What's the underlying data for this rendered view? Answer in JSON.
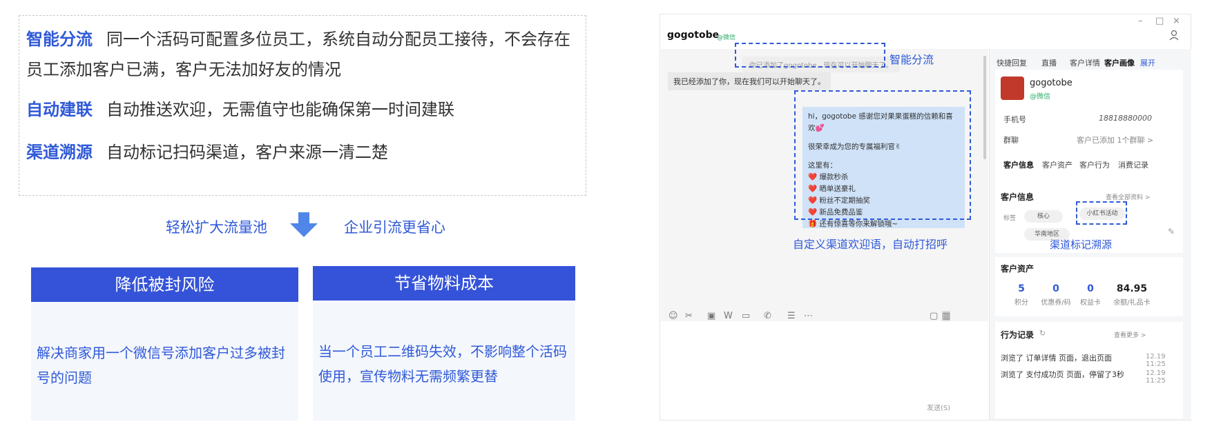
{
  "features": [
    {
      "title": "智能分流",
      "text": "同一个活码可配置多位员工，系统自动分配员工接待，不会存在员工添加客户已满，客户无法加好友的情况"
    },
    {
      "title": "自动建联",
      "text": "自动推送欢迎，无需值守也能确保第一时间建联"
    },
    {
      "title": "渠道溯源",
      "text": "自动标记扫码渠道，客户来源一清二楚"
    }
  ],
  "benefits": {
    "left": "轻松扩大流量池",
    "right": "企业引流更省心"
  },
  "cards": [
    {
      "title": "降低被封风险",
      "body": "解决商家用一个微信号添加客户过多被封号的问题"
    },
    {
      "title": "节省物料成本",
      "body": "当一个员工二维码失效，不影响整个活码使用，宣传物料无需频繁更替"
    }
  ],
  "window": {
    "controls": {
      "min": "–",
      "max": "□",
      "close": "×"
    },
    "contact_name": "gogotobe",
    "contact_source": "@微信",
    "system_msg": "你已添加了gogotobe，现在可以开始聊天了。",
    "received_msg": "我已经添加了你，现在我们可以开始聊天了。",
    "welcome_lines": [
      "hi，gogotobe 感谢您对果果蛋糕的信赖和喜欢💕",
      "",
      "很荣幸成为您的专属福利官✌",
      "",
      "这里有：",
      "❤️ 爆款秒杀",
      "❤️ 晒单送豪礼",
      "❤️ 粉丝不定期抽奖",
      "❤️ 新品免费品鉴",
      "🎁 还有惊喜等你来解锁哦~"
    ],
    "send_label": "发送(S)",
    "annotations": {
      "smart_route": "智能分流",
      "welcome": "自定义渠道欢迎语，自动打招呼",
      "channel_tag": "渠道标记溯源"
    },
    "side": {
      "tabs": [
        "快捷回复",
        "直播",
        "客户详情",
        "客户画像",
        "展开"
      ],
      "profile_name": "gogotobe",
      "profile_source": "@微信",
      "phone_label": "手机号",
      "phone_value": "18818880000",
      "group_label": "群聊",
      "group_value": "客户已添加 1个群聊 >",
      "sub_tabs": [
        "客户信息",
        "客户资产",
        "客户行为",
        "消费记录"
      ],
      "info_title": "客户信息",
      "info_link": "查看全部资料 >",
      "tag_label": "标签",
      "tags": [
        "核心",
        "小红书活动",
        "华南地区"
      ],
      "assets_title": "客户资产",
      "assets": [
        {
          "value": "5",
          "label": "积分"
        },
        {
          "value": "0",
          "label": "优惠券/码"
        },
        {
          "value": "0",
          "label": "权益卡"
        },
        {
          "value": "84.95",
          "label": "余额/礼品卡"
        }
      ],
      "behavior_title": "行为记录",
      "behavior_link": "查看更多 >",
      "behaviors": [
        {
          "text": "浏览了 订单详情 页面，退出页面",
          "time": "12.19 11:25"
        },
        {
          "text": "浏览了 支付成功页 页面，停留了3秒",
          "time": "12.19 11:25"
        }
      ]
    }
  }
}
